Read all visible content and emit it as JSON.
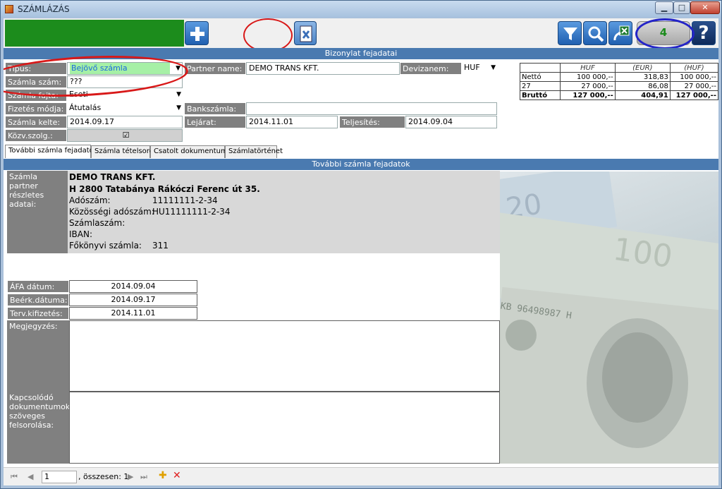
{
  "window": {
    "title": "SZÁMLÁZÁS",
    "min": "▁",
    "max": "□",
    "close": "✕"
  },
  "toolbar": {
    "counter": "4",
    "help": "?"
  },
  "header_section": "Bizonylat fejadatai",
  "form": {
    "tipus_label": "Típus:",
    "tipus_value": "Bejövő számla",
    "szamla_szam_label": "Számla szám:",
    "szamla_szam_value": "???",
    "szamla_fajta_label": "Számla fajta:",
    "szamla_fajta_value": "Eseti",
    "fizetes_label": "Fizetés módja:",
    "fizetes_value": "Átutalás",
    "kelte_label": "Számla kelte:",
    "kelte_value": "2014.09.17",
    "kozv_label": "Közv.szolg.:",
    "partner_label": "Partner name:",
    "partner_value": "DEMO TRANS KFT.",
    "devizanem_label": "Devizanem:",
    "devizanem_value": "HUF",
    "bankszamla_label": "Bankszámla:",
    "lejarat_label": "Lejárat:",
    "lejarat_value": "2014.11.01",
    "teljesites_label": "Teljesítés:",
    "teljesites_value": "2014.09.04"
  },
  "summary": {
    "headers": [
      "",
      "HUF",
      "(EUR)",
      "(HUF)"
    ],
    "rows": [
      [
        "Nettó",
        "100 000,--",
        "318,83",
        "100 000,--"
      ],
      [
        "27",
        "27 000,--",
        "86,08",
        "27 000,--"
      ],
      [
        "Bruttó",
        "127 000,--",
        "404,91",
        "127 000,--"
      ]
    ]
  },
  "tabs": [
    "További számla fejadatok",
    "Számla tételsorok",
    "Csatolt dokumentumok",
    "Számlatörténet"
  ],
  "detail_section": "További számla fejadatok",
  "detail": {
    "partner_label": "Számla partner részletes adatai:",
    "name": "DEMO TRANS KFT.",
    "address": "H 2800 Tatabánya Rákóczi Ferenc út 35.",
    "adoszam_label": "Adószám:",
    "adoszam": "11111111-2-34",
    "kozossegi_label": "Közösségi adószám:",
    "kozossegi": "HU11111111-2-34",
    "szamlaszam_label": "Számlaszám:",
    "iban_label": "IBAN:",
    "fokonyv_label": "Főkönyvi számla:",
    "fokonyv": "311"
  },
  "dates": {
    "afa_label": "ÁFA dátum:",
    "afa": "2014.09.04",
    "beerk_label": "Beérk.dátuma:",
    "beerk": "2014.09.17",
    "terv_label": "Terv.kifizetés:",
    "terv": "2014.11.01"
  },
  "notes": {
    "megjegyzes_label": "Megjegyzés:",
    "kapcsolodo_label": "Kapcsolódó dokumentumok szöveges felsorolása:"
  },
  "navigator": {
    "position": "1",
    "total": ", összesen: 1"
  }
}
